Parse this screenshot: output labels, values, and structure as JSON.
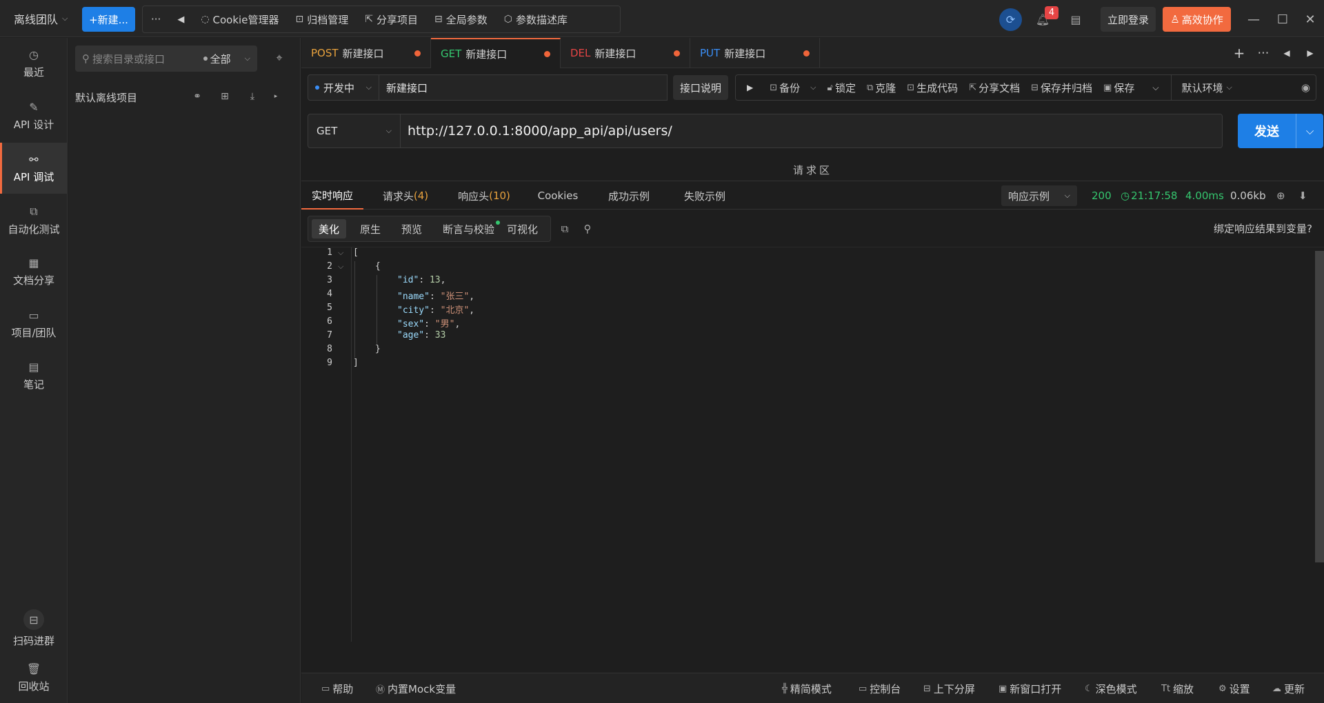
{
  "topbar": {
    "team": "离线团队",
    "new_button": "+新建...",
    "more": "···",
    "tools": [
      "Cookie管理器",
      "归档管理",
      "分享项目",
      "全局参数",
      "参数描述库"
    ],
    "badge_count": "4",
    "login": "立即登录",
    "collab": "高效协作"
  },
  "leftnav": {
    "items": [
      {
        "label": "最近",
        "icon": "clock-icon"
      },
      {
        "label": "API 设计",
        "icon": "edit-icon"
      },
      {
        "label": "API 调试",
        "icon": "link-icon"
      },
      {
        "label": "自动化测试",
        "icon": "flow-icon"
      },
      {
        "label": "文档分享",
        "icon": "doc-icon"
      },
      {
        "label": "项目/团队",
        "icon": "stack-icon"
      },
      {
        "label": "笔记",
        "icon": "note-icon"
      },
      {
        "label": "扫码进群",
        "icon": "qr-icon"
      },
      {
        "label": "回收站",
        "icon": "trash-icon"
      }
    ]
  },
  "project_panel": {
    "search_placeholder": "搜索目录或接口",
    "filter": "全部",
    "project_name": "默认离线项目"
  },
  "tabs": [
    {
      "method": "POST",
      "name": "新建接口",
      "color": "#e8a23d"
    },
    {
      "method": "GET",
      "name": "新建接口",
      "color": "#35c76f"
    },
    {
      "method": "DEL",
      "name": "新建接口",
      "color": "#e64545"
    },
    {
      "method": "PUT",
      "name": "新建接口",
      "color": "#3a8ef6"
    }
  ],
  "request": {
    "env_status": "开发中",
    "api_name": "新建接口",
    "desc_button": "接口说明",
    "actions": [
      "备份",
      "锁定",
      "克隆",
      "生成代码",
      "分享文档",
      "保存并归档",
      "保存"
    ],
    "environment": "默认环境",
    "method": "GET",
    "url": "http://127.0.0.1:8000/app_api/api/users/",
    "send": "发送",
    "request_area": "请求区"
  },
  "response": {
    "tabs": [
      {
        "label": "实时响应",
        "count": ""
      },
      {
        "label": "请求头",
        "count": "(4)"
      },
      {
        "label": "响应头",
        "count": "(10)"
      },
      {
        "label": "Cookies",
        "count": ""
      },
      {
        "label": "成功示例",
        "count": ""
      },
      {
        "label": "失败示例",
        "count": ""
      }
    ],
    "example_select": "响应示例",
    "status_code": "200",
    "time": "21:17:58",
    "duration": "4.00ms",
    "size": "0.06kb",
    "view_tabs": [
      "美化",
      "原生",
      "预览",
      "断言与校验",
      "可视化"
    ],
    "bind_link": "绑定响应结果到变量?",
    "code": {
      "l1": "[",
      "l2": "{",
      "id_key": "\"id\"",
      "id_val": "13",
      "name_key": "\"name\"",
      "name_val": "\"张三\"",
      "city_key": "\"city\"",
      "city_val": "\"北京\"",
      "sex_key": "\"sex\"",
      "sex_val": "\"男\"",
      "age_key": "\"age\"",
      "age_val": "33",
      "l8": "}",
      "l9": "]"
    }
  },
  "footer": {
    "left": [
      "帮助",
      "内置Mock变量"
    ],
    "right": [
      "精简模式",
      "控制台",
      "上下分屏",
      "新窗口打开",
      "深色模式",
      "缩放",
      "设置",
      "更新"
    ]
  }
}
